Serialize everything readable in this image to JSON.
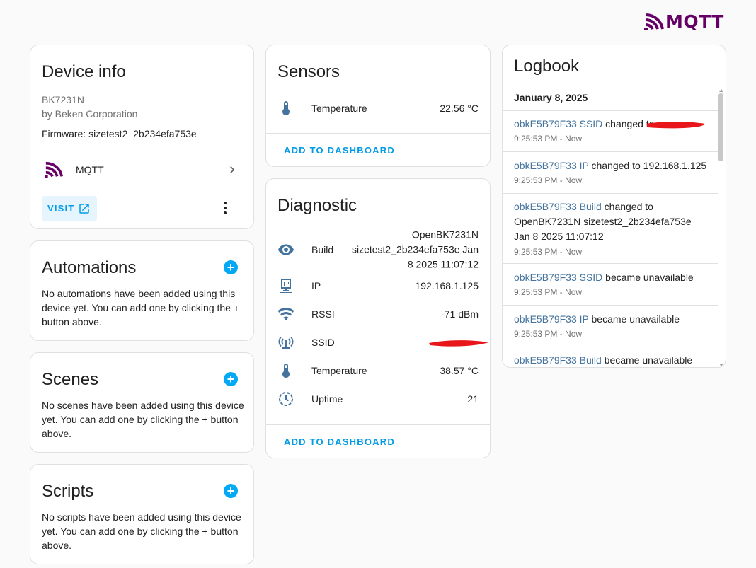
{
  "brand": {
    "name": "MQTT"
  },
  "device_info": {
    "title": "Device info",
    "model": "BK7231N",
    "manufacturer": "by Beken Corporation",
    "firmware": "Firmware: sizetest2_2b234efa753e",
    "integration_label": "MQTT",
    "visit_label": "VISIT"
  },
  "automations": {
    "title": "Automations",
    "empty_text": "No automations have been added using this device yet. You can add one by clicking the + button above."
  },
  "scenes": {
    "title": "Scenes",
    "empty_text": "No scenes have been added using this device yet. You can add one by clicking the + button above."
  },
  "scripts": {
    "title": "Scripts",
    "empty_text": "No scripts have been added using this device yet. You can add one by clicking the + button above."
  },
  "sensors": {
    "title": "Sensors",
    "rows": [
      {
        "icon": "thermometer-icon",
        "label": "Temperature",
        "value": "22.56 °C"
      }
    ],
    "add_label": "ADD TO DASHBOARD"
  },
  "diagnostic": {
    "title": "Diagnostic",
    "rows": [
      {
        "icon": "eye-icon",
        "label": "Build",
        "value": "OpenBK7231N sizetest2_2b234efa753e Jan 8 2025 11:07:12"
      },
      {
        "icon": "ip-network-icon",
        "label": "IP",
        "value": "192.168.1.125"
      },
      {
        "icon": "wifi-icon",
        "label": "RSSI",
        "value": "-71 dBm"
      },
      {
        "icon": "access-point-icon",
        "label": "SSID",
        "value": ""
      },
      {
        "icon": "thermometer-icon",
        "label": "Temperature",
        "value": "38.57 °C"
      },
      {
        "icon": "clock-icon",
        "label": "Uptime",
        "value": "21"
      }
    ],
    "add_label": "ADD TO DASHBOARD"
  },
  "logbook": {
    "title": "Logbook",
    "date": "January 8, 2025",
    "entries": [
      {
        "entity": "obkE5B79F33 SSID",
        "message": " changed to ",
        "time": "9:25:53 PM - Now"
      },
      {
        "entity": "obkE5B79F33 IP",
        "message": " changed to 192.168.1.125",
        "time": "9:25:53 PM - Now"
      },
      {
        "entity": "obkE5B79F33 Build",
        "message": " changed to OpenBK7231N sizetest2_2b234efa753e Jan 8 2025 11:07:12",
        "time": "9:25:53 PM - Now"
      },
      {
        "entity": "obkE5B79F33 SSID",
        "message": " became unavailable",
        "time": "9:25:53 PM - Now"
      },
      {
        "entity": "obkE5B79F33 IP",
        "message": " became unavailable",
        "time": "9:25:53 PM - Now"
      },
      {
        "entity": "obkE5B79F33 Build",
        "message": " became unavailable",
        "time": ""
      }
    ]
  },
  "colors": {
    "accent": "#03a9f4",
    "link": "#039be5",
    "entity_icon": "#44739e",
    "brand": "#660066",
    "redaction": "#e8161b"
  }
}
